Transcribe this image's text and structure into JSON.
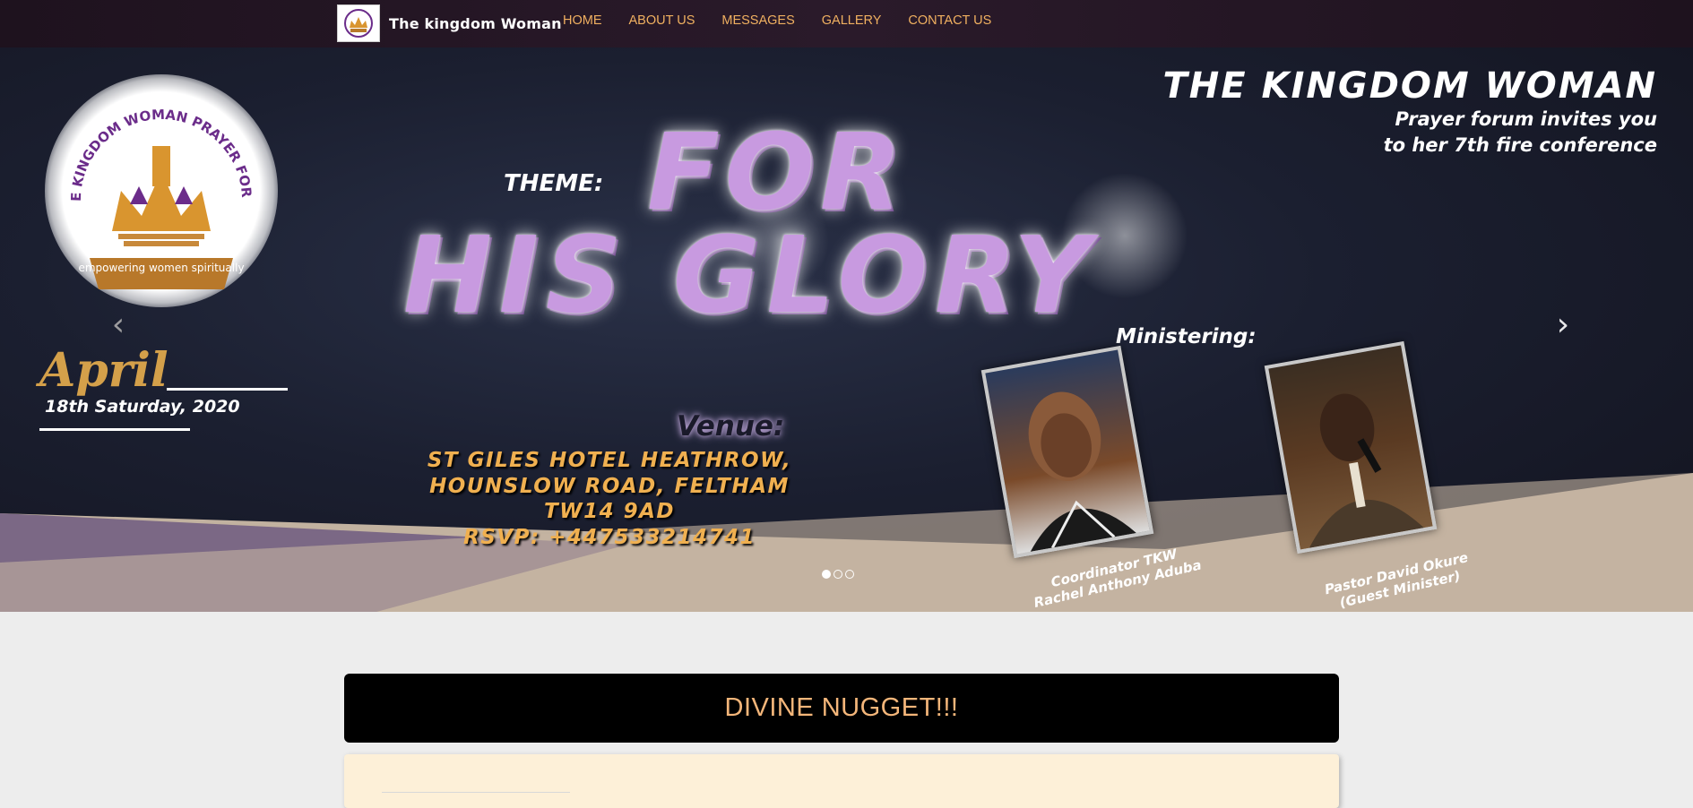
{
  "navbar": {
    "brand": "The kingdom Woman",
    "links": [
      "HOME",
      "ABOUT US",
      "MESSAGES",
      "GALLERY",
      "CONTACT US"
    ]
  },
  "banner": {
    "crest_text": "THE KINGDOM WOMAN PRAYER FORUM",
    "crest_tagline": "empowering women spiritually",
    "title": "THE KINGDOM WOMAN",
    "subtitle_line1": "Prayer forum invites you",
    "subtitle_line2": "to her 7th fire conference",
    "theme_label": "THEME:",
    "theme_line1": "FOR",
    "theme_line2": "HIS GLORY",
    "ministering_label": "Ministering:",
    "date_month": "April",
    "date_day": "18th Saturday, 2020",
    "venue_label": "Venue:",
    "venue_lines": [
      "ST GILES HOTEL HEATHROW,",
      "HOUNSLOW ROAD, FELTHAM",
      "TW14 9AD",
      "RSVP: +447533214741"
    ],
    "speaker1_caption_line1": "Coordinator TKW",
    "speaker1_caption_line2": "Rachel Anthony Aduba",
    "speaker2_caption_line1": "Pastor David Okure",
    "speaker2_caption_line2": "(Guest Minister)",
    "prev_icon": "‹",
    "next_icon": "›",
    "slide_count": 3,
    "active_slide": 1
  },
  "section": {
    "heading": "DIVINE NUGGET!!!"
  },
  "colors": {
    "nav_link": "#f0b060",
    "nugget_title": "#f4b67a",
    "nugget_body_bg": "#fdf0d8",
    "venue_text": "#f0b050",
    "theme_text": "#c89ae0"
  }
}
